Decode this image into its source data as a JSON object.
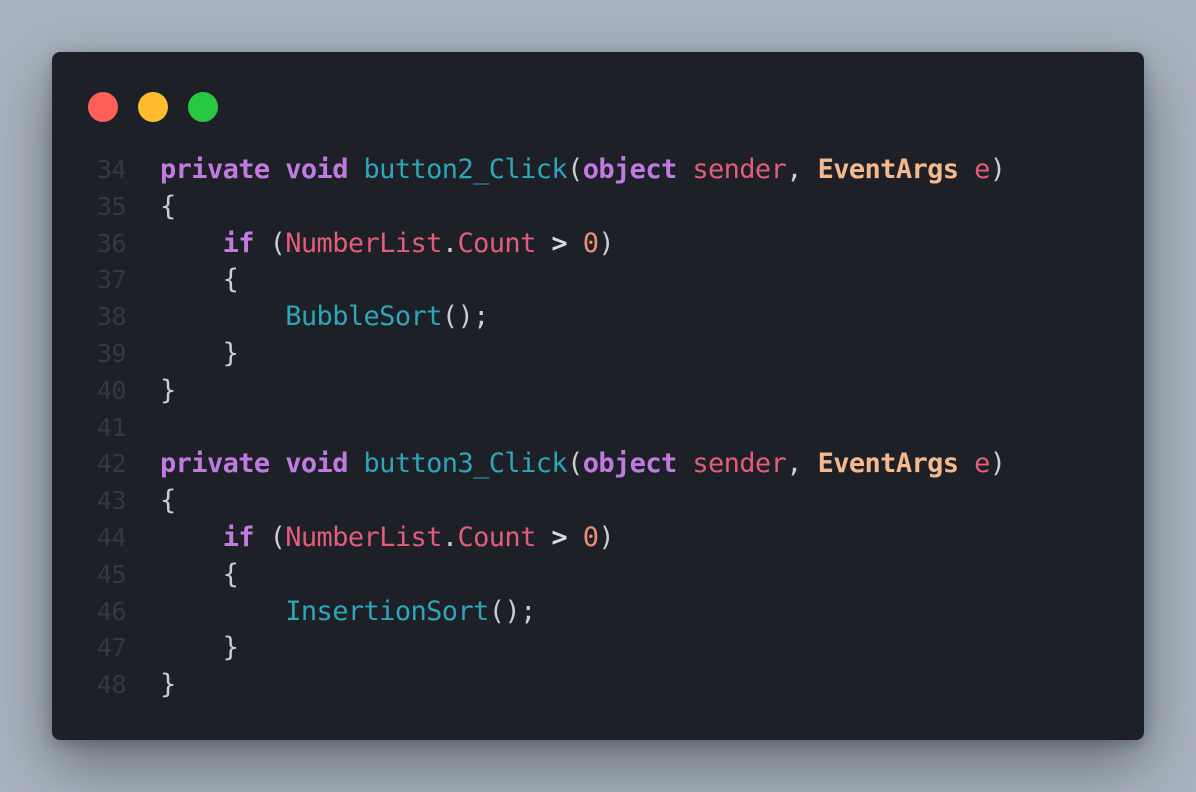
{
  "window": {
    "controls": [
      {
        "name": "close",
        "color": "#ff5f57"
      },
      {
        "name": "minimize",
        "color": "#febc2e"
      },
      {
        "name": "zoom",
        "color": "#28c840"
      }
    ]
  },
  "code": {
    "lines": [
      {
        "num": "34",
        "tokens": [
          {
            "t": "private",
            "c": "kw"
          },
          {
            "t": " ",
            "c": "pn"
          },
          {
            "t": "void",
            "c": "kw"
          },
          {
            "t": " ",
            "c": "pn"
          },
          {
            "t": "button2_Click",
            "c": "fn"
          },
          {
            "t": "(",
            "c": "pn"
          },
          {
            "t": "object",
            "c": "kw"
          },
          {
            "t": " ",
            "c": "pn"
          },
          {
            "t": "sender",
            "c": "id"
          },
          {
            "t": ", ",
            "c": "pn"
          },
          {
            "t": "EventArgs",
            "c": "ty"
          },
          {
            "t": " ",
            "c": "pn"
          },
          {
            "t": "e",
            "c": "id"
          },
          {
            "t": ")",
            "c": "pn"
          }
        ]
      },
      {
        "num": "35",
        "tokens": [
          {
            "t": "{",
            "c": "pn"
          }
        ]
      },
      {
        "num": "36",
        "tokens": [
          {
            "t": "    ",
            "c": "pn"
          },
          {
            "t": "if",
            "c": "kw"
          },
          {
            "t": " (",
            "c": "pn"
          },
          {
            "t": "NumberList",
            "c": "id"
          },
          {
            "t": ".",
            "c": "pn"
          },
          {
            "t": "Count",
            "c": "id"
          },
          {
            "t": " ",
            "c": "pn"
          },
          {
            "t": ">",
            "c": "op"
          },
          {
            "t": " ",
            "c": "pn"
          },
          {
            "t": "0",
            "c": "nm"
          },
          {
            "t": ")",
            "c": "pn"
          }
        ]
      },
      {
        "num": "37",
        "tokens": [
          {
            "t": "    {",
            "c": "pn"
          }
        ]
      },
      {
        "num": "38",
        "tokens": [
          {
            "t": "        ",
            "c": "pn"
          },
          {
            "t": "BubbleSort",
            "c": "fn"
          },
          {
            "t": "();",
            "c": "pn"
          }
        ]
      },
      {
        "num": "39",
        "tokens": [
          {
            "t": "    }",
            "c": "pn"
          }
        ]
      },
      {
        "num": "40",
        "tokens": [
          {
            "t": "}",
            "c": "pn"
          }
        ]
      },
      {
        "num": "41",
        "tokens": []
      },
      {
        "num": "42",
        "tokens": [
          {
            "t": "private",
            "c": "kw"
          },
          {
            "t": " ",
            "c": "pn"
          },
          {
            "t": "void",
            "c": "kw"
          },
          {
            "t": " ",
            "c": "pn"
          },
          {
            "t": "button3_Click",
            "c": "fn"
          },
          {
            "t": "(",
            "c": "pn"
          },
          {
            "t": "object",
            "c": "kw"
          },
          {
            "t": " ",
            "c": "pn"
          },
          {
            "t": "sender",
            "c": "id"
          },
          {
            "t": ", ",
            "c": "pn"
          },
          {
            "t": "EventArgs",
            "c": "ty"
          },
          {
            "t": " ",
            "c": "pn"
          },
          {
            "t": "e",
            "c": "id"
          },
          {
            "t": ")",
            "c": "pn"
          }
        ]
      },
      {
        "num": "43",
        "tokens": [
          {
            "t": "{",
            "c": "pn"
          }
        ]
      },
      {
        "num": "44",
        "tokens": [
          {
            "t": "    ",
            "c": "pn"
          },
          {
            "t": "if",
            "c": "kw"
          },
          {
            "t": " (",
            "c": "pn"
          },
          {
            "t": "NumberList",
            "c": "id"
          },
          {
            "t": ".",
            "c": "pn"
          },
          {
            "t": "Count",
            "c": "id"
          },
          {
            "t": " ",
            "c": "pn"
          },
          {
            "t": ">",
            "c": "op"
          },
          {
            "t": " ",
            "c": "pn"
          },
          {
            "t": "0",
            "c": "nm"
          },
          {
            "t": ")",
            "c": "pn"
          }
        ]
      },
      {
        "num": "45",
        "tokens": [
          {
            "t": "    {",
            "c": "pn"
          }
        ]
      },
      {
        "num": "46",
        "tokens": [
          {
            "t": "        ",
            "c": "pn"
          },
          {
            "t": "InsertionSort",
            "c": "fn"
          },
          {
            "t": "();",
            "c": "pn"
          }
        ]
      },
      {
        "num": "47",
        "tokens": [
          {
            "t": "    }",
            "c": "pn"
          }
        ]
      },
      {
        "num": "48",
        "tokens": [
          {
            "t": "}",
            "c": "pn"
          }
        ]
      }
    ]
  }
}
